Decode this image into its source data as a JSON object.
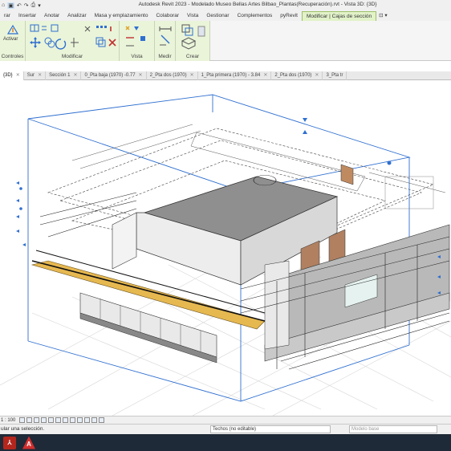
{
  "app": {
    "title": "Autodesk Revit 2023 - Modelado Museo Bellas Artes Bilbao_Plantas(Recuperación).rvt - Vista 3D: {3D}"
  },
  "qat": [
    "⌂",
    "▣",
    "↶",
    "↷",
    "⎙",
    "▾"
  ],
  "ribbon_tabs": [
    {
      "label": "rar",
      "active": false
    },
    {
      "label": "Insertar",
      "active": false
    },
    {
      "label": "Anotar",
      "active": false
    },
    {
      "label": "Analizar",
      "active": false
    },
    {
      "label": "Masa y emplazamiento",
      "active": false
    },
    {
      "label": "Colaborar",
      "active": false
    },
    {
      "label": "Vista",
      "active": false
    },
    {
      "label": "Gestionar",
      "active": false
    },
    {
      "label": "Complementos",
      "active": false
    },
    {
      "label": "pyRevit",
      "active": false
    },
    {
      "label": "Modificar | Cajas de sección",
      "active": true
    },
    {
      "label": "⊡ ▾",
      "active": false
    }
  ],
  "ribbon_groups": {
    "controles": {
      "label": "Controles",
      "button": "Activar"
    },
    "modificar": {
      "label": "Modificar"
    },
    "vista": {
      "label": "Vista"
    },
    "medir": {
      "label": "Medir"
    },
    "crear": {
      "label": "Crear"
    }
  },
  "view_tabs": [
    {
      "label": "{3D}",
      "active": true
    },
    {
      "label": "Sur",
      "active": false
    },
    {
      "label": "Sección 1",
      "active": false
    },
    {
      "label": "0_Pta baja (1970) -0.77",
      "active": false
    },
    {
      "label": "2_Pta dos (1970)",
      "active": false
    },
    {
      "label": "1_Pta primera (1970) - 3.84",
      "active": false
    },
    {
      "label": "2_Pta dos (1970)",
      "active": false
    },
    {
      "label": "3_Pta tr",
      "active": false
    }
  ],
  "view_control": {
    "scale": "1 : 100"
  },
  "status": {
    "message": "ular una selección.",
    "type_field": "Techos (no editable)",
    "model_field": "Modelo base"
  },
  "taskbar": {
    "apps": [
      {
        "name": "pdf-app",
        "glyph": "⅄"
      },
      {
        "name": "autocad-app",
        "glyph": "A"
      }
    ]
  },
  "colors": {
    "ribbon_active": "#eaf4d9",
    "accent_blue": "#2f6fd0",
    "wall_brown": "#b08060",
    "floor_yellow": "#e6b850"
  }
}
